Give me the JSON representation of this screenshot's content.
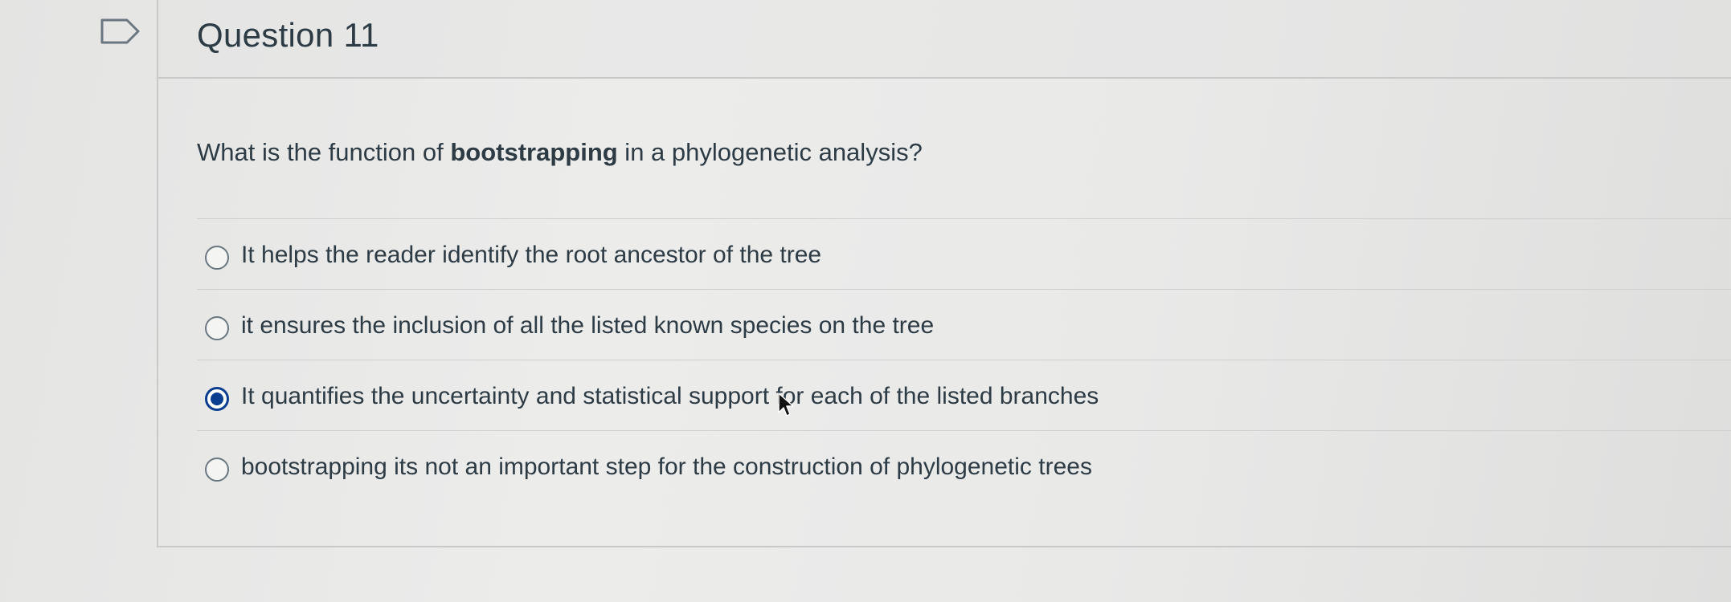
{
  "question": {
    "title": "Question 11",
    "text_before": "What is the function of ",
    "text_bold": "bootstrapping",
    "text_after": " in a phylogenetic analysis?"
  },
  "answers": [
    {
      "label": "It helps the reader identify the root ancestor of the tree",
      "selected": false
    },
    {
      "label": "it ensures the inclusion of all the listed known species on the tree",
      "selected": false
    },
    {
      "label": "It quantifies the uncertainty and statistical support for each of the listed branches",
      "selected": true
    },
    {
      "label": "bootstrapping its not an important step for the construction of phylogenetic trees",
      "selected": false
    }
  ],
  "icons": {
    "flag": "flag-outline-icon",
    "cursor": "mouse-pointer-icon"
  },
  "colors": {
    "text": "#2d3b45",
    "selected_radio": "#0b3d91",
    "divider": "#c9c9c9"
  }
}
